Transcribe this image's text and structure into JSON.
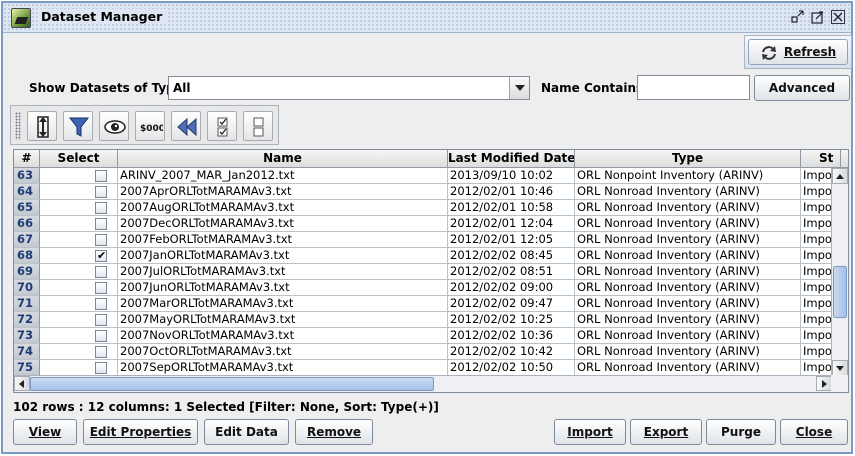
{
  "window": {
    "title": "Dataset Manager",
    "controls": {
      "minimize": "▫▪",
      "maximize": "↗",
      "close": "✕"
    }
  },
  "toolbar_top": {
    "refresh_label": "Refresh"
  },
  "filter": {
    "type_label": "Show Datasets of Type:",
    "type_value": "All",
    "name_label": "Name Contains:",
    "name_value": "",
    "advanced_label": "Advanced"
  },
  "table": {
    "columns": [
      "#",
      "Select",
      "Name",
      "Last Modified Date",
      "Type",
      "St"
    ],
    "rows": [
      {
        "num": "63",
        "checked": false,
        "name": "ARINV_2007_MAR_Jan2012.txt",
        "date": "2013/09/10 10:02",
        "type": "ORL Nonpoint Inventory (ARINV)",
        "status": "Impor"
      },
      {
        "num": "64",
        "checked": false,
        "name": "2007AprORLTotMARAMAv3.txt",
        "date": "2012/02/01 10:46",
        "type": "ORL Nonroad Inventory (ARINV)",
        "status": "Impor"
      },
      {
        "num": "65",
        "checked": false,
        "name": "2007AugORLTotMARAMAv3.txt",
        "date": "2012/02/01 10:58",
        "type": "ORL Nonroad Inventory (ARINV)",
        "status": "Impor"
      },
      {
        "num": "66",
        "checked": false,
        "name": "2007DecORLTotMARAMAv3.txt",
        "date": "2012/02/01 12:04",
        "type": "ORL Nonroad Inventory (ARINV)",
        "status": "Impor"
      },
      {
        "num": "67",
        "checked": false,
        "name": "2007FebORLTotMARAMAv3.txt",
        "date": "2012/02/01 12:05",
        "type": "ORL Nonroad Inventory (ARINV)",
        "status": "Impor"
      },
      {
        "num": "68",
        "checked": true,
        "name": "2007JanORLTotMARAMAv3.txt",
        "date": "2012/02/02 08:45",
        "type": "ORL Nonroad Inventory (ARINV)",
        "status": "Impor"
      },
      {
        "num": "69",
        "checked": false,
        "name": "2007JulORLTotMARAMAv3.txt",
        "date": "2012/02/02 08:51",
        "type": "ORL Nonroad Inventory (ARINV)",
        "status": "Impor"
      },
      {
        "num": "70",
        "checked": false,
        "name": "2007JunORLTotMARAMAv3.txt",
        "date": "2012/02/02 09:00",
        "type": "ORL Nonroad Inventory (ARINV)",
        "status": "Impor"
      },
      {
        "num": "71",
        "checked": false,
        "name": "2007MarORLTotMARAMAv3.txt",
        "date": "2012/02/02 09:47",
        "type": "ORL Nonroad Inventory (ARINV)",
        "status": "Impor"
      },
      {
        "num": "72",
        "checked": false,
        "name": "2007MayORLTotMARAMAv3.txt",
        "date": "2012/02/02 10:25",
        "type": "ORL Nonroad Inventory (ARINV)",
        "status": "Impor"
      },
      {
        "num": "73",
        "checked": false,
        "name": "2007NovORLTotMARAMAv3.txt",
        "date": "2012/02/02 10:36",
        "type": "ORL Nonroad Inventory (ARINV)",
        "status": "Impor"
      },
      {
        "num": "74",
        "checked": false,
        "name": "2007OctORLTotMARAMAv3.txt",
        "date": "2012/02/02 10:42",
        "type": "ORL Nonroad Inventory (ARINV)",
        "status": "Impor"
      },
      {
        "num": "75",
        "checked": false,
        "name": "2007SepORLTotMARAMAv3.txt",
        "date": "2012/02/02 10:50",
        "type": "ORL Nonroad Inventory (ARINV)",
        "status": "Impor"
      }
    ]
  },
  "status_text": "102 rows : 12 columns: 1 Selected [Filter: None, Sort: Type(+)]",
  "buttons": {
    "view": "View",
    "edit_properties": "Edit Properties",
    "edit_data": "Edit Data",
    "remove": "Remove",
    "import": "Import",
    "export": "Export",
    "purge": "Purge",
    "close": "Close"
  },
  "icons": [
    "app-icon",
    "refresh-icon",
    "sort-icon",
    "filter-icon",
    "eye-icon",
    "money-icon",
    "rewind-icon",
    "select-checklist-icon",
    "deselect-checklist-icon"
  ]
}
